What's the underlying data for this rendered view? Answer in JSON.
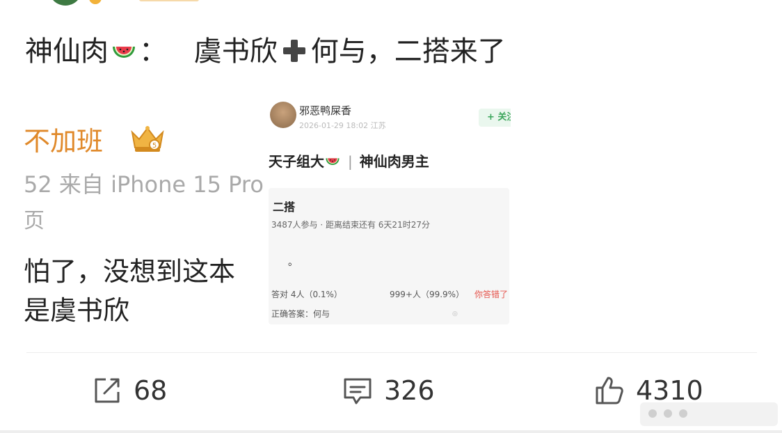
{
  "post": {
    "author": "神仙肉",
    "colon": "：",
    "text_part1": "虞书欣",
    "text_part2": "何与，二搭来了"
  },
  "background_post": {
    "username_fragment": "不加班",
    "meta_fragment": "52  来自 iPhone 15 Pro",
    "line_fragment": "页",
    "text_line1": "怕了，没想到这本",
    "text_line2": "是虞书欣"
  },
  "embedded_screenshot": {
    "username": "邪恶鸭屎香",
    "timestamp": "2026-01-29 18:02  江苏",
    "follow_label": "+ 关注",
    "headline_left": "天子组大",
    "headline_separator": "|",
    "headline_right": "神仙肉男主",
    "question_title": "二搭",
    "participants": "3487人参与 · 距离结束还有 6天21时27分",
    "option_text": "。",
    "correct_count": "答对  4人（0.1%）",
    "wrong_count": "999+人（99.9%）",
    "wrong_label": "你答错了",
    "answer": "正确答案：何与"
  },
  "actions": {
    "share_count": "68",
    "comment_count": "326",
    "like_count": "4310"
  },
  "colors": {
    "username_orange": "#e0892a",
    "follow_green": "#3aa55a",
    "wrong_red": "#e5534b",
    "meta_gray": "#a9a9a9"
  },
  "icons": [
    "watermelon-emoji",
    "plus-emoji",
    "crown-badge-icon",
    "share-icon",
    "comment-icon",
    "like-icon"
  ]
}
